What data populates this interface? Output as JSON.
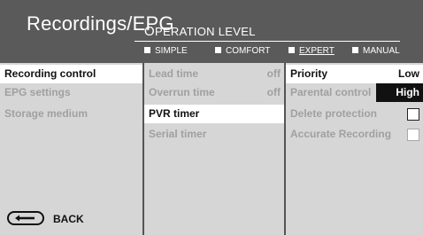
{
  "header": {
    "title": "Recordings/EPG",
    "level_title_first": "O",
    "level_title_rest": "PERATION LEVEL",
    "options": [
      {
        "label": "SIMPLE",
        "selected": false
      },
      {
        "label": "COMFORT",
        "selected": false
      },
      {
        "label": "EXPERT",
        "selected": true
      },
      {
        "label": "MANUAL",
        "selected": false
      }
    ]
  },
  "menu": [
    {
      "label": "Recording control",
      "active": true
    },
    {
      "label": "EPG settings",
      "active": false
    },
    {
      "label": "Storage medium",
      "active": false
    }
  ],
  "submenu": [
    {
      "label": "Lead time",
      "value": "off",
      "active": false
    },
    {
      "label": "Overrun time",
      "value": "off",
      "active": false
    },
    {
      "label": "PVR timer",
      "value": "",
      "active": true
    },
    {
      "label": "Serial timer",
      "value": "",
      "active": false
    }
  ],
  "settings": [
    {
      "label": "Priority",
      "value": "Low",
      "type": "value",
      "active": true
    },
    {
      "label": "Parental control",
      "value": "High",
      "type": "value-highlight",
      "active": false
    },
    {
      "label": "Delete protection",
      "type": "checkbox",
      "checked": false,
      "enabled": true
    },
    {
      "label": "Accurate Recording",
      "type": "checkbox",
      "checked": false,
      "enabled": false
    }
  ],
  "footer": {
    "back_label": "BACK",
    "back_icon": "back-arrow-icon"
  },
  "colors": {
    "header_bg": "#5a5a5a",
    "panel_bg": "#d6d6d6",
    "active_row_bg": "#ffffff",
    "disabled_text": "#a0a0a0",
    "highlight_bg": "#111111"
  }
}
